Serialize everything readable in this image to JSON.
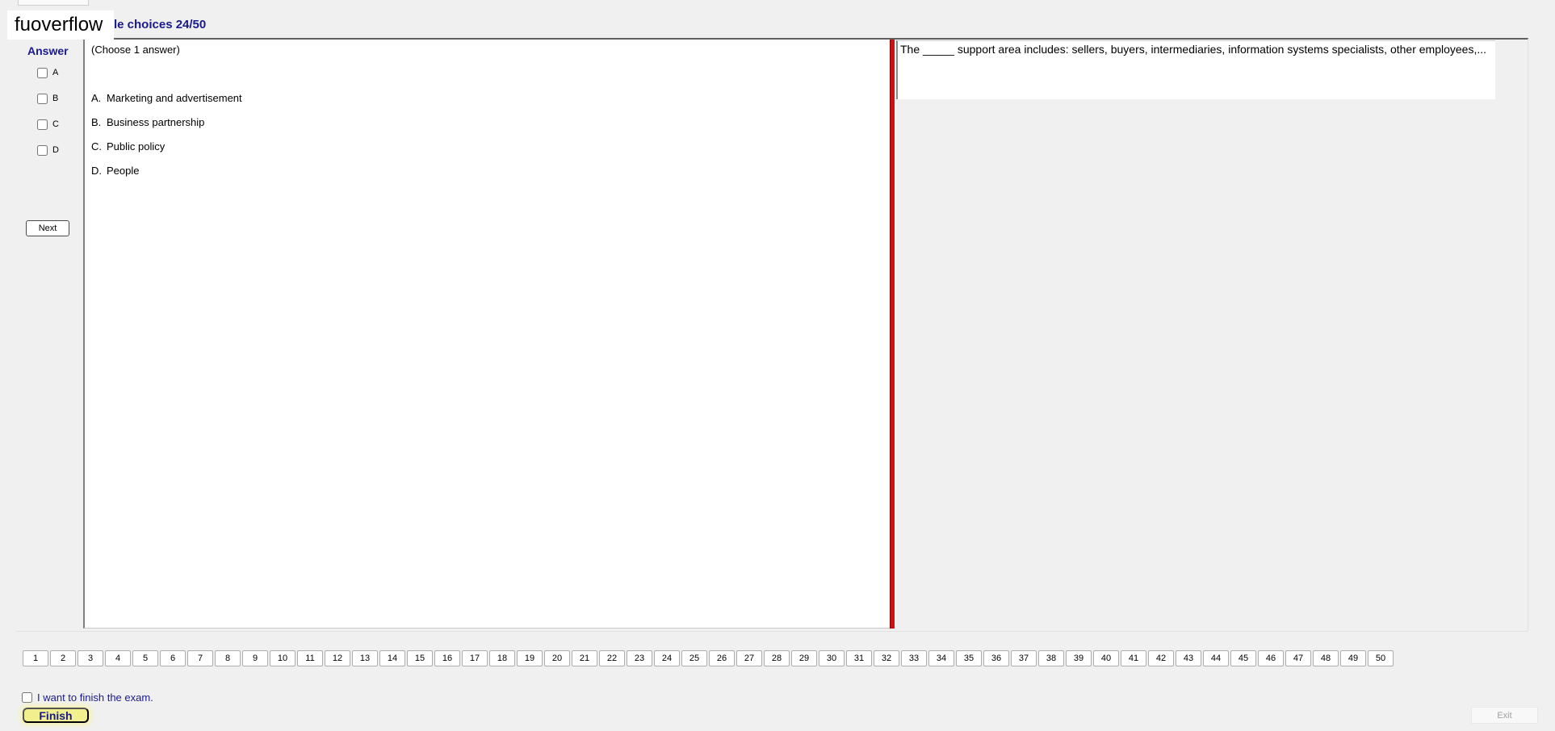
{
  "watermark": "fuoverflow",
  "header": {
    "title": "Multiple choices 24/50",
    "visible_title": "le choices 24/50"
  },
  "answer_panel": {
    "label": "Answer",
    "options": [
      {
        "letter": "A",
        "checked": false
      },
      {
        "letter": "B",
        "checked": false
      },
      {
        "letter": "C",
        "checked": false
      },
      {
        "letter": "D",
        "checked": false
      }
    ],
    "next_label": "Next"
  },
  "question": {
    "hint": "(Choose 1 answer)",
    "choices": [
      {
        "letter": "A.",
        "text": "Marketing and advertisement"
      },
      {
        "letter": "B.",
        "text": "Business partnership"
      },
      {
        "letter": "C.",
        "text": "Public policy"
      },
      {
        "letter": "D.",
        "text": "People"
      }
    ],
    "text": "The _____ support area includes: sellers, buyers, intermediaries, information systems specialists, other employees,..."
  },
  "navigation": {
    "current": 24,
    "total": 50,
    "buttons": [
      "1",
      "2",
      "3",
      "4",
      "5",
      "6",
      "7",
      "8",
      "9",
      "10",
      "11",
      "12",
      "13",
      "14",
      "15",
      "16",
      "17",
      "18",
      "19",
      "20",
      "21",
      "22",
      "23",
      "24",
      "25",
      "26",
      "27",
      "28",
      "29",
      "30",
      "31",
      "32",
      "33",
      "34",
      "35",
      "36",
      "37",
      "38",
      "39",
      "40",
      "41",
      "42",
      "43",
      "44",
      "45",
      "46",
      "47",
      "48",
      "49",
      "50"
    ]
  },
  "footer": {
    "finish_checkbox_label": "I want to finish the exam.",
    "finish_label": "Finish",
    "exit_label": "Exit"
  },
  "colors": {
    "accent": "#1a1a8c",
    "divider": "#cc1111",
    "finish_bg": "#f2ef8e"
  }
}
